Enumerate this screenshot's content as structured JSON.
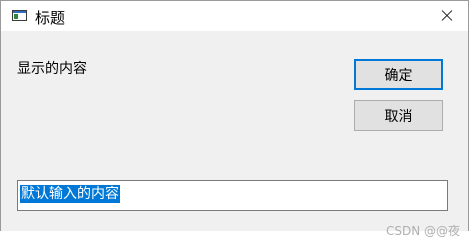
{
  "window": {
    "title": "标题"
  },
  "dialog": {
    "prompt": "显示的内容",
    "ok_label": "确定",
    "cancel_label": "取消",
    "input_value": "默认输入的内容"
  },
  "watermark": "CSDN @@夜",
  "colors": {
    "accent": "#0078d7",
    "window_bg": "#f0f0f0",
    "button_bg": "#e1e1e1"
  },
  "icons": {
    "app": "window-app-icon",
    "close": "close-icon"
  }
}
